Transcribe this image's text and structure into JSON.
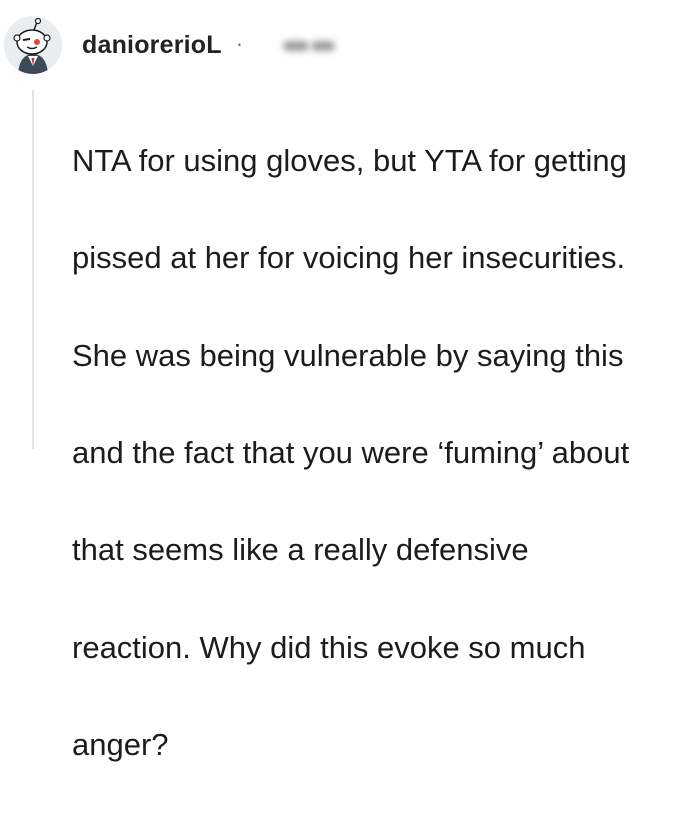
{
  "comment": {
    "author": {
      "username": "daniorerioL",
      "avatar": "reddit-snoo-avatar"
    },
    "separator": "·",
    "body_lines": [
      "NTA for using gloves, but YTA for getting",
      "pissed at her for voicing her insecurities.",
      "She was being vulnerable by saying this",
      "and the fact that you were ‘fuming’ about",
      "that seems like a really defensive",
      "reaction. Why did this evoke so much",
      "anger?"
    ]
  },
  "colors": {
    "text": "#1c1c1c",
    "username": "#222222",
    "thread_line": "#e3e3e3",
    "background": "#ffffff"
  }
}
